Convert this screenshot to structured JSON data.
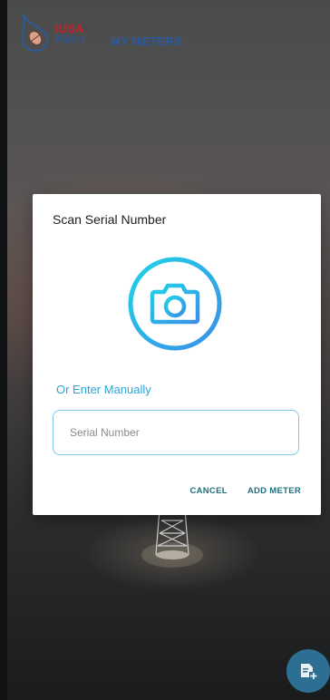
{
  "brand": {
    "logo_line1": "IUSA",
    "logo_line2": "Water"
  },
  "header": {
    "title": "MY METERS"
  },
  "dialog": {
    "title": "Scan Serial Number",
    "camera_icon": "camera-icon",
    "manual_label": "Or Enter Manually",
    "serial_input": {
      "value": "",
      "placeholder": "Serial Number"
    },
    "cancel_label": "CANCEL",
    "add_label": "ADD METER"
  },
  "fab": {
    "icon": "add-document-icon"
  },
  "colors": {
    "accent": "#2aa6d9",
    "brand_red": "#c8202a",
    "brand_blue": "#2a5aa0",
    "action_text": "#1f6f7d",
    "fab": "#2d6f93"
  }
}
